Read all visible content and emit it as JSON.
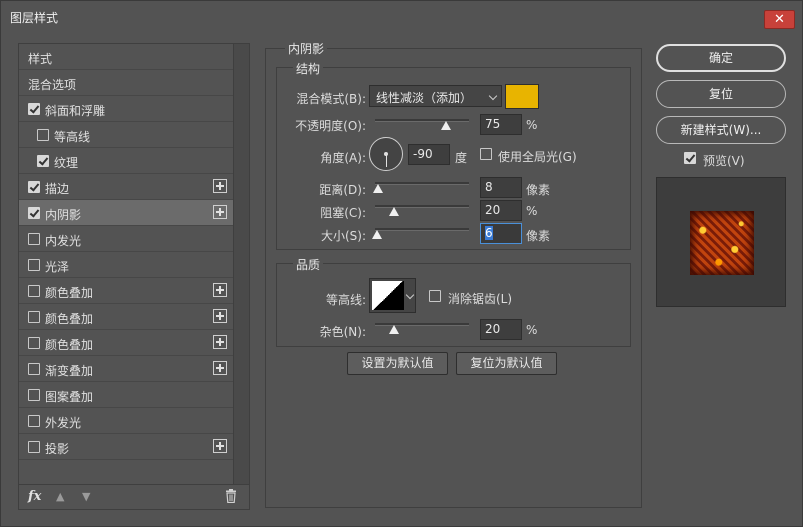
{
  "window": {
    "title": "图层样式",
    "close": "✕"
  },
  "left": {
    "items": [
      {
        "label": "样式",
        "checkbox": false,
        "checked": false,
        "plus": false,
        "indent": 0,
        "selected": false
      },
      {
        "label": "混合选项",
        "checkbox": false,
        "checked": false,
        "plus": false,
        "indent": 0,
        "selected": false
      },
      {
        "label": "斜面和浮雕",
        "checkbox": true,
        "checked": true,
        "plus": false,
        "indent": 0,
        "selected": false
      },
      {
        "label": "等高线",
        "checkbox": true,
        "checked": false,
        "plus": false,
        "indent": 1,
        "selected": false
      },
      {
        "label": "纹理",
        "checkbox": true,
        "checked": true,
        "plus": false,
        "indent": 1,
        "selected": false
      },
      {
        "label": "描边",
        "checkbox": true,
        "checked": true,
        "plus": true,
        "indent": 0,
        "selected": false
      },
      {
        "label": "内阴影",
        "checkbox": true,
        "checked": true,
        "plus": true,
        "indent": 0,
        "selected": true
      },
      {
        "label": "内发光",
        "checkbox": true,
        "checked": false,
        "plus": false,
        "indent": 0,
        "selected": false
      },
      {
        "label": "光泽",
        "checkbox": true,
        "checked": false,
        "plus": false,
        "indent": 0,
        "selected": false
      },
      {
        "label": "颜色叠加",
        "checkbox": true,
        "checked": false,
        "plus": true,
        "indent": 0,
        "selected": false
      },
      {
        "label": "颜色叠加",
        "checkbox": true,
        "checked": false,
        "plus": true,
        "indent": 0,
        "selected": false
      },
      {
        "label": "颜色叠加",
        "checkbox": true,
        "checked": false,
        "plus": true,
        "indent": 0,
        "selected": false
      },
      {
        "label": "渐变叠加",
        "checkbox": true,
        "checked": false,
        "plus": true,
        "indent": 0,
        "selected": false
      },
      {
        "label": "图案叠加",
        "checkbox": true,
        "checked": false,
        "plus": false,
        "indent": 0,
        "selected": false
      },
      {
        "label": "外发光",
        "checkbox": true,
        "checked": false,
        "plus": false,
        "indent": 0,
        "selected": false
      },
      {
        "label": "投影",
        "checkbox": true,
        "checked": false,
        "plus": true,
        "indent": 0,
        "selected": false
      }
    ],
    "footer": {
      "fx": "fx",
      "up": "▲",
      "down": "▼"
    }
  },
  "panel": {
    "title": "内阴影",
    "structure": {
      "title": "结构",
      "blend_label": "混合模式(B):",
      "blend_value": "线性减淡（添加）",
      "color": "#e8b400",
      "opacity_label": "不透明度(O):",
      "opacity": {
        "value": "75",
        "unit": "%",
        "fraction": 0.75
      },
      "angle_label": "角度(A):",
      "angle": {
        "value": "-90",
        "unit": "度"
      },
      "global_light": "使用全局光(G)",
      "distance_label": "距离(D):",
      "distance": {
        "value": "8",
        "unit": "像素",
        "fraction": 0.03
      },
      "choke_label": "阻塞(C):",
      "choke": {
        "value": "20",
        "unit": "%",
        "fraction": 0.2
      },
      "size_label": "大小(S):",
      "size": {
        "value": "6",
        "unit": "像素",
        "fraction": 0.02
      }
    },
    "quality": {
      "title": "品质",
      "contour_label": "等高线:",
      "antialias": "消除锯齿(L)",
      "noise_label": "杂色(N):",
      "noise": {
        "value": "20",
        "unit": "%",
        "fraction": 0.2
      }
    },
    "buttons": {
      "set_default": "设置为默认值",
      "reset_default": "复位为默认值"
    }
  },
  "right": {
    "ok": "确定",
    "reset": "复位",
    "new_style": "新建样式(W)...",
    "preview_label": "预览(V)",
    "preview_checked": true
  }
}
